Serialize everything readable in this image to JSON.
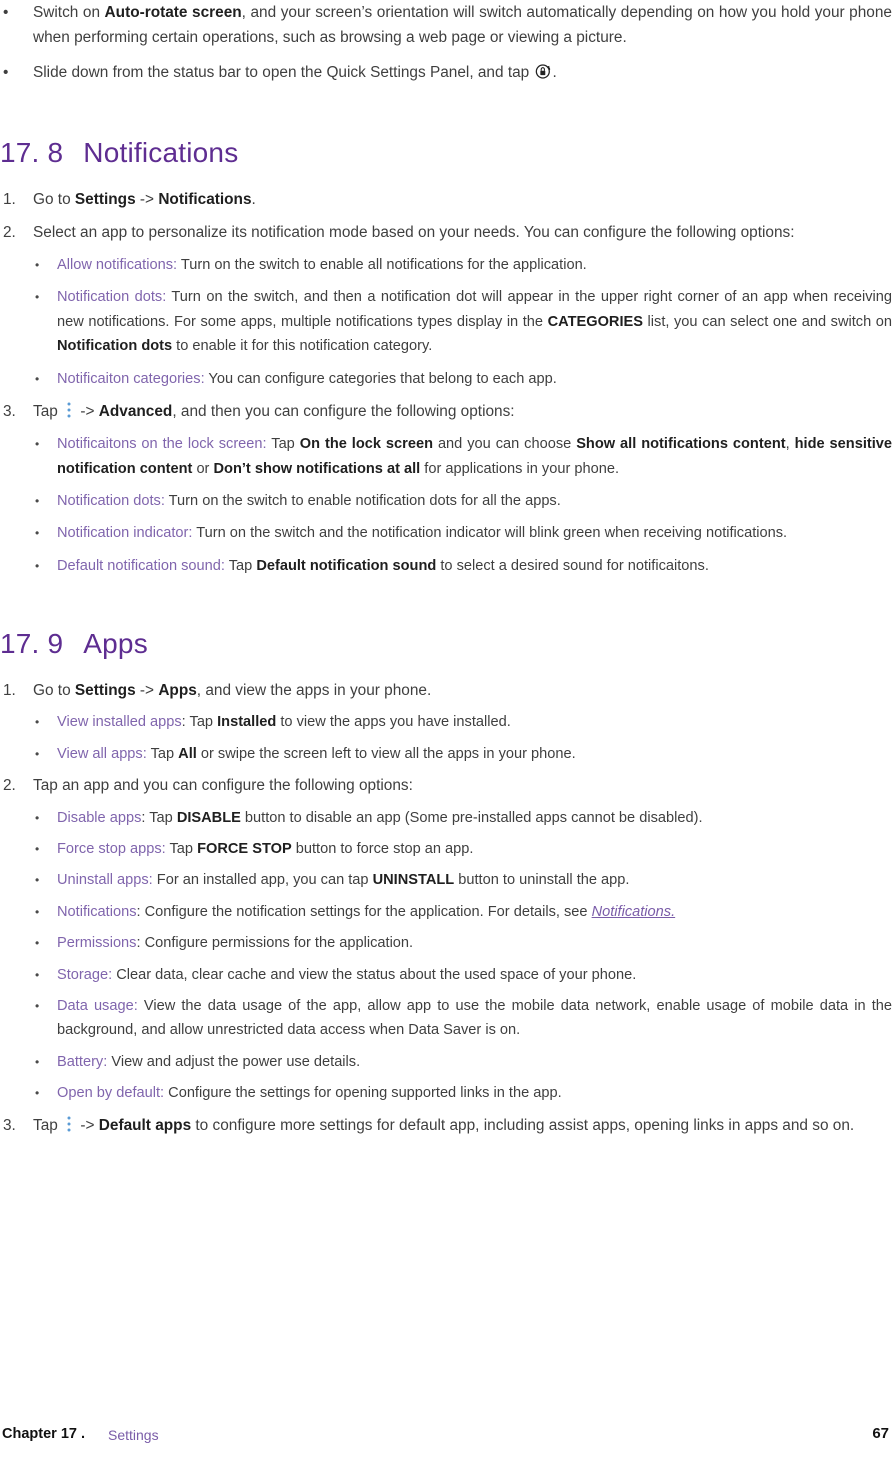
{
  "document": {
    "type": "user-manual-page",
    "colors": {
      "heading_purple": "#5e2d91",
      "label_purple": "#8065ad",
      "link_purple": "#7a5ca8",
      "body_text": "#3f3f3f",
      "bold_text": "#1f1f1f",
      "kebab_icon_blue": "#5b9bd5",
      "page_background": "#ffffff"
    }
  },
  "intro_bullets": [
    {
      "marker": "•",
      "segments": [
        {
          "text": "Switch on ",
          "style": "normal"
        },
        {
          "text": "Auto-rotate screen",
          "style": "bold"
        },
        {
          "text": ", and your screen’s orientation will switch automatically depending on how you hold your phone when performing certain operations, such as browsing a web page or viewing a picture.",
          "style": "normal"
        }
      ]
    },
    {
      "marker": "•",
      "segments": [
        {
          "text": "Slide down from the status bar to open the Quick Settings Panel, and tap ",
          "style": "normal"
        },
        {
          "icon": "rotation-lock-icon"
        },
        {
          "text": ".",
          "style": "normal"
        }
      ]
    }
  ],
  "section_notifications": {
    "heading": {
      "number": "17. 8",
      "title": "Notifications"
    },
    "steps": [
      {
        "marker": "1.",
        "segments": [
          {
            "text": "Go to ",
            "style": "normal"
          },
          {
            "text": "Settings",
            "style": "bold"
          },
          {
            "text": " -> ",
            "style": "normal"
          },
          {
            "text": "Notifications",
            "style": "bold"
          },
          {
            "text": ".",
            "style": "normal"
          }
        ],
        "sub_bullets": []
      },
      {
        "marker": "2.",
        "segments": [
          {
            "text": "Select an app to personalize its notification mode based on your needs. You can configure the following options:",
            "style": "normal"
          }
        ],
        "sub_bullets": [
          {
            "marker": "•",
            "segments": [
              {
                "text": "Allow notifications:",
                "style": "label"
              },
              {
                "text": " Turn on the switch to enable all notifications for the application.",
                "style": "normal"
              }
            ]
          },
          {
            "marker": "•",
            "segments": [
              {
                "text": "Notification dots:",
                "style": "label"
              },
              {
                "text": " Turn on the switch, and then a notification dot will appear in the upper right corner of an app when receiving new notifications. For some apps, multiple notifications types display in the ",
                "style": "normal"
              },
              {
                "text": "CATEGORIES",
                "style": "bold"
              },
              {
                "text": " list, you can select one and switch on ",
                "style": "normal"
              },
              {
                "text": "Notification dots",
                "style": "bold"
              },
              {
                "text": " to enable it for this notification category.",
                "style": "normal"
              }
            ]
          },
          {
            "marker": "•",
            "segments": [
              {
                "text": "Notificaiton categories:",
                "style": "label"
              },
              {
                "text": " You can configure categories that belong to each app.",
                "style": "normal"
              }
            ]
          }
        ]
      },
      {
        "marker": "3.",
        "segments": [
          {
            "text": "Tap ",
            "style": "normal"
          },
          {
            "icon": "kebab-menu-icon"
          },
          {
            "text": " -> ",
            "style": "normal"
          },
          {
            "text": "Advanced",
            "style": "bold"
          },
          {
            "text": ", and then you can configure the following options:",
            "style": "normal"
          }
        ],
        "sub_bullets": [
          {
            "marker": "•",
            "segments": [
              {
                "text": "Notificaitons on the lock screen:",
                "style": "label"
              },
              {
                "text": " Tap ",
                "style": "normal"
              },
              {
                "text": "On the lock screen",
                "style": "bold"
              },
              {
                "text": " and you can choose ",
                "style": "normal"
              },
              {
                "text": "Show all notifications content",
                "style": "bold"
              },
              {
                "text": ", ",
                "style": "normal"
              },
              {
                "text": "hide sensitive notification content",
                "style": "bold"
              },
              {
                "text": " or ",
                "style": "normal"
              },
              {
                "text": "Don’t show notifications at all",
                "style": "bold"
              },
              {
                "text": " for applications in your phone.",
                "style": "normal"
              }
            ]
          },
          {
            "marker": "•",
            "segments": [
              {
                "text": "Notification dots:",
                "style": "label"
              },
              {
                "text": " Turn on the switch to enable notification dots for all the apps.",
                "style": "normal"
              }
            ]
          },
          {
            "marker": "•",
            "segments": [
              {
                "text": "Notification indicator:",
                "style": "label"
              },
              {
                "text": " Turn on the switch and the notification indicator will blink green when receiving notifications.",
                "style": "normal"
              }
            ]
          },
          {
            "marker": "•",
            "segments": [
              {
                "text": "Default notification sound:",
                "style": "label"
              },
              {
                "text": " Tap ",
                "style": "normal"
              },
              {
                "text": "Default notification sound",
                "style": "bold"
              },
              {
                "text": " to select a desired sound for notificaitons.",
                "style": "normal"
              }
            ]
          }
        ]
      }
    ]
  },
  "section_apps": {
    "heading": {
      "number": "17. 9",
      "title": "Apps"
    },
    "steps": [
      {
        "marker": "1.",
        "segments": [
          {
            "text": "Go to ",
            "style": "normal"
          },
          {
            "text": "Settings",
            "style": "bold"
          },
          {
            "text": " -> ",
            "style": "normal"
          },
          {
            "text": "Apps",
            "style": "bold"
          },
          {
            "text": ", and view the apps in your phone.",
            "style": "normal"
          }
        ],
        "sub_bullets": [
          {
            "marker": "•",
            "segments": [
              {
                "text": "View installed apps",
                "style": "label"
              },
              {
                "text": ": Tap ",
                "style": "normal"
              },
              {
                "text": "Installed",
                "style": "bold"
              },
              {
                "text": " to view the apps you have installed.",
                "style": "normal"
              }
            ]
          },
          {
            "marker": "•",
            "segments": [
              {
                "text": "View all apps:",
                "style": "label"
              },
              {
                "text": " Tap ",
                "style": "normal"
              },
              {
                "text": "All",
                "style": "bold"
              },
              {
                "text": " or swipe the screen left to view all the apps in your phone.",
                "style": "normal"
              }
            ]
          }
        ]
      },
      {
        "marker": "2.",
        "segments": [
          {
            "text": "Tap an app and you can configure the following options:",
            "style": "normal"
          }
        ],
        "sub_bullets": [
          {
            "marker": "•",
            "segments": [
              {
                "text": "Disable apps",
                "style": "label"
              },
              {
                "text": ": Tap ",
                "style": "normal"
              },
              {
                "text": "DISABLE",
                "style": "bold"
              },
              {
                "text": " button to disable an app (Some pre-installed apps cannot be disabled).",
                "style": "normal"
              }
            ]
          },
          {
            "marker": "•",
            "segments": [
              {
                "text": "Force stop apps:",
                "style": "label"
              },
              {
                "text": " Tap ",
                "style": "normal"
              },
              {
                "text": "FORCE STOP",
                "style": "bold"
              },
              {
                "text": " button to force stop an app.",
                "style": "normal"
              }
            ]
          },
          {
            "marker": "•",
            "segments": [
              {
                "text": "Uninstall apps:",
                "style": "label"
              },
              {
                "text": " For an installed app, you can tap ",
                "style": "normal"
              },
              {
                "text": "UNINSTALL",
                "style": "bold"
              },
              {
                "text": " button to uninstall the app.",
                "style": "normal"
              }
            ]
          },
          {
            "marker": "•",
            "segments": [
              {
                "text": "Notifications",
                "style": "label"
              },
              {
                "text": ": Configure the notification settings for the application. For details, see ",
                "style": "normal"
              },
              {
                "text": "Notifications.",
                "style": "link"
              }
            ]
          },
          {
            "marker": "•",
            "segments": [
              {
                "text": "Permissions",
                "style": "label"
              },
              {
                "text": ": Configure permissions for the application.",
                "style": "normal"
              }
            ]
          },
          {
            "marker": "•",
            "segments": [
              {
                "text": "Storage:",
                "style": "label"
              },
              {
                "text": " Clear data, clear cache and view the status about the used space of your phone.",
                "style": "normal"
              }
            ]
          },
          {
            "marker": "•",
            "segments": [
              {
                "text": "Data usage:",
                "style": "label"
              },
              {
                "text": " View the data usage of the app, allow app to use the mobile data network, enable usage of mobile data in the background, and allow unrestricted data access when Data Saver is on.",
                "style": "normal"
              }
            ]
          },
          {
            "marker": "•",
            "segments": [
              {
                "text": "Battery:",
                "style": "label"
              },
              {
                "text": " View and adjust the power use details.",
                "style": "normal"
              }
            ]
          },
          {
            "marker": "•",
            "segments": [
              {
                "text": "Open by default:",
                "style": "label"
              },
              {
                "text": " Configure the settings for opening supported links in the app.",
                "style": "normal"
              }
            ]
          }
        ]
      },
      {
        "marker": "3.",
        "segments": [
          {
            "text": "Tap ",
            "style": "normal"
          },
          {
            "icon": "kebab-menu-icon"
          },
          {
            "text": " -> ",
            "style": "normal"
          },
          {
            "text": "Default apps",
            "style": "bold"
          },
          {
            "text": " to configure more settings for default app, including assist apps, opening links in apps and so on.",
            "style": "normal"
          }
        ],
        "sub_bullets": []
      }
    ]
  },
  "footer": {
    "chapter": "Chapter 17 .",
    "section": "Settings",
    "page_number": "67"
  }
}
